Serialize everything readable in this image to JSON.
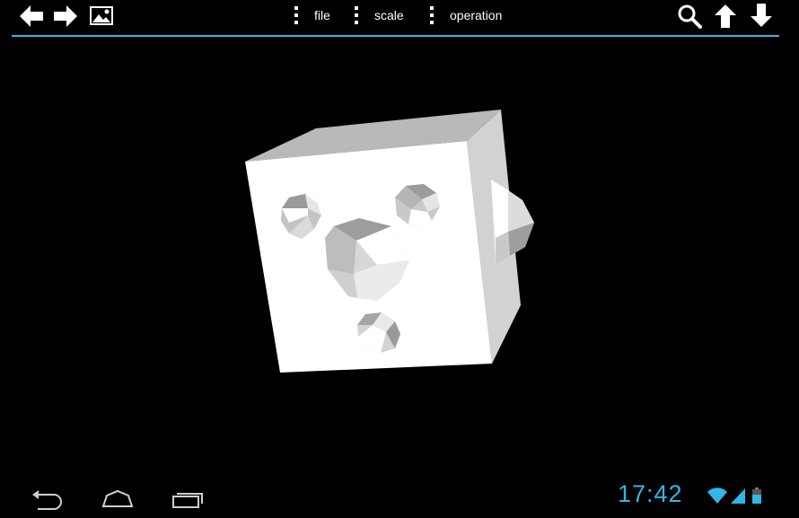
{
  "toolbar": {
    "back_icon": "arrow-left-icon",
    "forward_icon": "arrow-right-icon",
    "image_icon": "image-icon",
    "menus": [
      {
        "label": "file"
      },
      {
        "label": "scale"
      },
      {
        "label": "operation"
      }
    ],
    "search_icon": "search-icon",
    "up_icon": "arrow-up-icon",
    "down_icon": "arrow-down-icon",
    "accent_color": "#33b5e5"
  },
  "viewport": {
    "model_icon": "3d-cube-model"
  },
  "system_bar": {
    "back_icon": "back-icon",
    "home_icon": "home-icon",
    "recents_icon": "recent-apps-icon",
    "time": "17:42",
    "wifi_icon": "wifi-icon",
    "signal_icon": "signal-icon",
    "battery_icon": "battery-icon"
  }
}
